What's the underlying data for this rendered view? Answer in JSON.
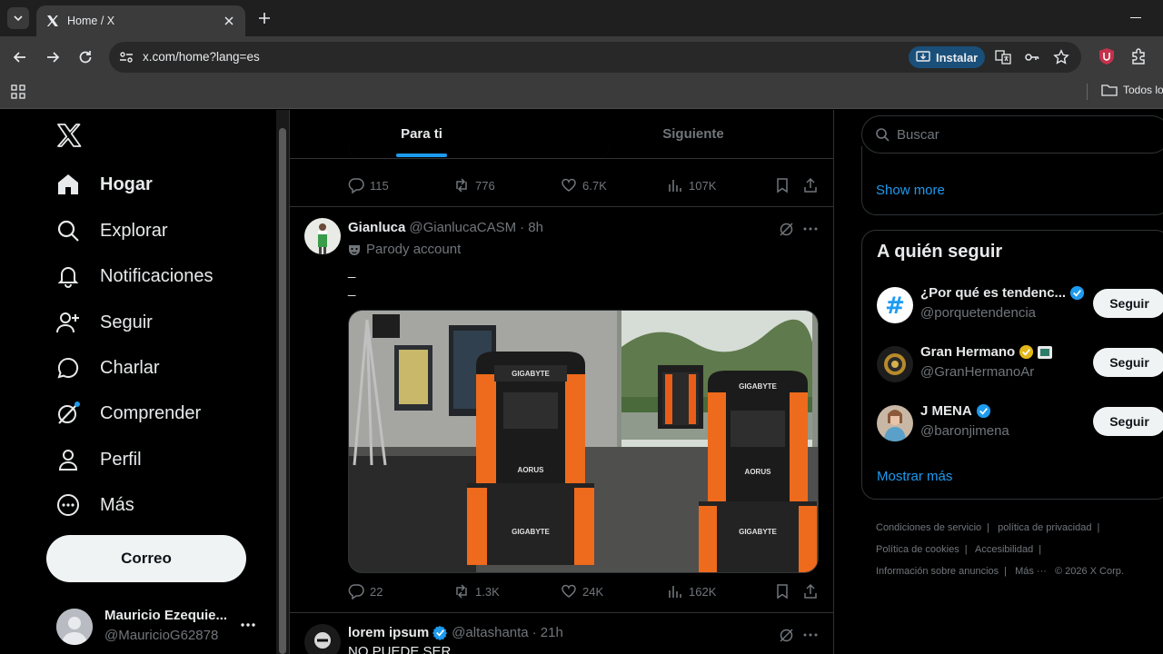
{
  "browser": {
    "tab_title": "Home / X",
    "url": "x.com/home?lang=es",
    "install_label": "Instalar",
    "bookmark_folder": "Todos lo"
  },
  "sidebar": {
    "items": [
      {
        "label": "Hogar",
        "icon": "home-icon"
      },
      {
        "label": "Explorar",
        "icon": "search-icon"
      },
      {
        "label": "Notificaciones",
        "icon": "bell-icon"
      },
      {
        "label": "Seguir",
        "icon": "follow-icon"
      },
      {
        "label": "Charlar",
        "icon": "chat-icon"
      },
      {
        "label": "Comprender",
        "icon": "grok-icon"
      },
      {
        "label": "Perfil",
        "icon": "person-icon"
      },
      {
        "label": "Más",
        "icon": "more-circle-icon"
      }
    ],
    "post_button": "Correo",
    "account": {
      "name": "Mauricio Ezequie...",
      "handle": "@MauricioG62878"
    }
  },
  "timeline": {
    "tabs": [
      "Para ti",
      "Siguiente"
    ],
    "prev_actions": {
      "replies": "115",
      "reposts": "776",
      "likes": "6.7K",
      "views": "107K"
    },
    "post1": {
      "name": "Gianluca",
      "handle": "@GianlucaCASM",
      "time": "· 8h",
      "parody": "Parody account",
      "line1": "_",
      "line2": "_",
      "actions": {
        "replies": "22",
        "reposts": "1.3K",
        "likes": "24K",
        "views": "162K"
      },
      "media_brand_1": "GIGABYTE",
      "media_brand_2": "AORUS"
    },
    "post2": {
      "name": "lorem ipsum",
      "handle": "@altashanta",
      "time": "· 21h",
      "text": "NO PUEDE SER"
    }
  },
  "right": {
    "search_placeholder": "Buscar",
    "show_more": "Show more",
    "who_title": "A quién seguir",
    "who": [
      {
        "name": "¿Por qué es tendenc...",
        "handle": "@porquetendencia",
        "button": "Seguir"
      },
      {
        "name": "Gran Hermano",
        "handle": "@GranHermanoAr",
        "button": "Seguir"
      },
      {
        "name": "J MENA",
        "handle": "@baronjimena",
        "button": "Seguir"
      }
    ],
    "show_more_2": "Mostrar más",
    "footer": [
      "Condiciones de servicio",
      "|",
      "política de privacidad",
      "|",
      "Política de cookies",
      "|",
      "Accesibilidad",
      "|",
      "Información sobre anuncios",
      "|",
      "Más ···",
      "© 2026 X Corp."
    ]
  },
  "colors": {
    "accent": "#1d9bf0",
    "background": "#000000",
    "orange": "#f06a1a"
  }
}
